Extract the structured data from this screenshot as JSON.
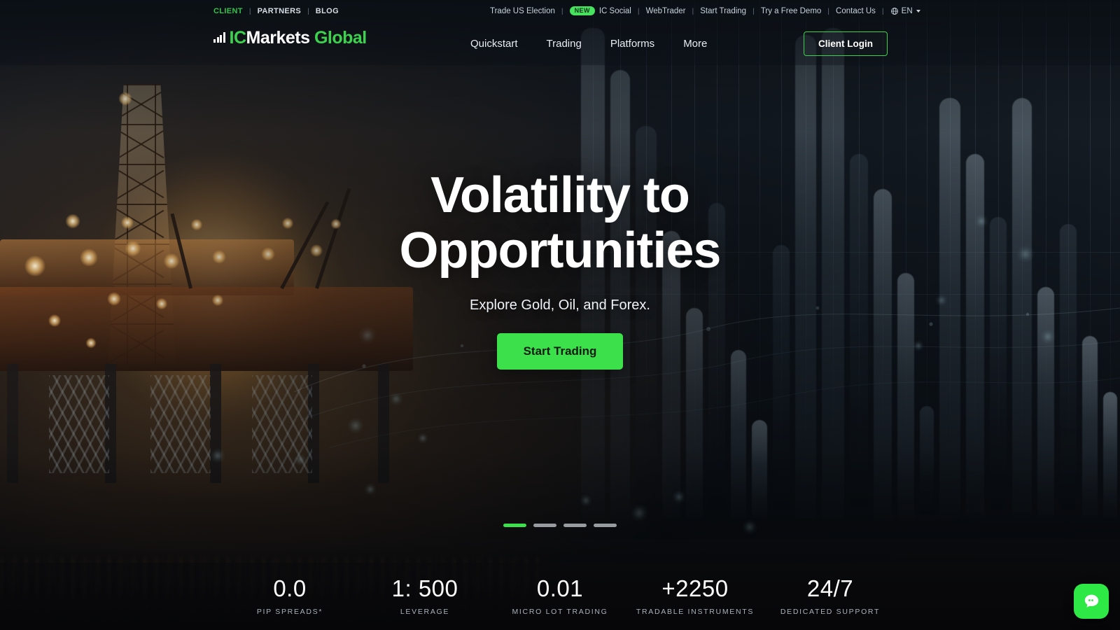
{
  "topbar": {
    "left_links": [
      {
        "label": "CLIENT",
        "accent": true
      },
      {
        "label": "PARTNERS",
        "accent": false
      },
      {
        "label": "BLOG",
        "accent": false
      }
    ],
    "separator": "|",
    "right_links": [
      {
        "label": "Trade US Election",
        "badge": null
      },
      {
        "label": "IC Social",
        "badge": "NEW"
      },
      {
        "label": "WebTrader",
        "badge": null
      },
      {
        "label": "Start Trading",
        "badge": null
      },
      {
        "label": "Try a Free Demo",
        "badge": null
      },
      {
        "label": "Contact Us",
        "badge": null
      }
    ],
    "language": "EN",
    "globe_icon": "globe-icon",
    "caret_icon": "chevron-down-icon"
  },
  "header": {
    "logo": {
      "icon": "bar-chart-icon",
      "part_one": "IC",
      "part_two": "Markets",
      "part_three": "Global"
    },
    "nav": [
      {
        "label": "Quickstart"
      },
      {
        "label": "Trading"
      },
      {
        "label": "Platforms"
      },
      {
        "label": "More"
      }
    ],
    "login_label": "Client Login"
  },
  "hero": {
    "title_line1": "Volatility to",
    "title_line2": "Opportunities",
    "subtitle": "Explore Gold, Oil, and Forex.",
    "cta_label": "Start Trading",
    "carousel": {
      "count": 4,
      "active_index": 0
    }
  },
  "stats": [
    {
      "value": "0.0",
      "label": "PIP SPREADS*"
    },
    {
      "value": "1: 500",
      "label": "LEVERAGE"
    },
    {
      "value": "0.01",
      "label": "MICRO LOT TRADING"
    },
    {
      "value": "+2250",
      "label": "TRADABLE INSTRUMENTS"
    },
    {
      "value": "24/7",
      "label": "DEDICATED SUPPORT"
    }
  ],
  "chat_widget": {
    "icon": "chat-bubble-icon"
  },
  "colors": {
    "brand_green": "#3cd24f",
    "cta_green": "#3ce04a",
    "badge_green": "#47e35e",
    "text_light": "#ffffff",
    "muted": "#a9b2ba",
    "bar_bg": "rgba(10,10,12,0.86)"
  }
}
